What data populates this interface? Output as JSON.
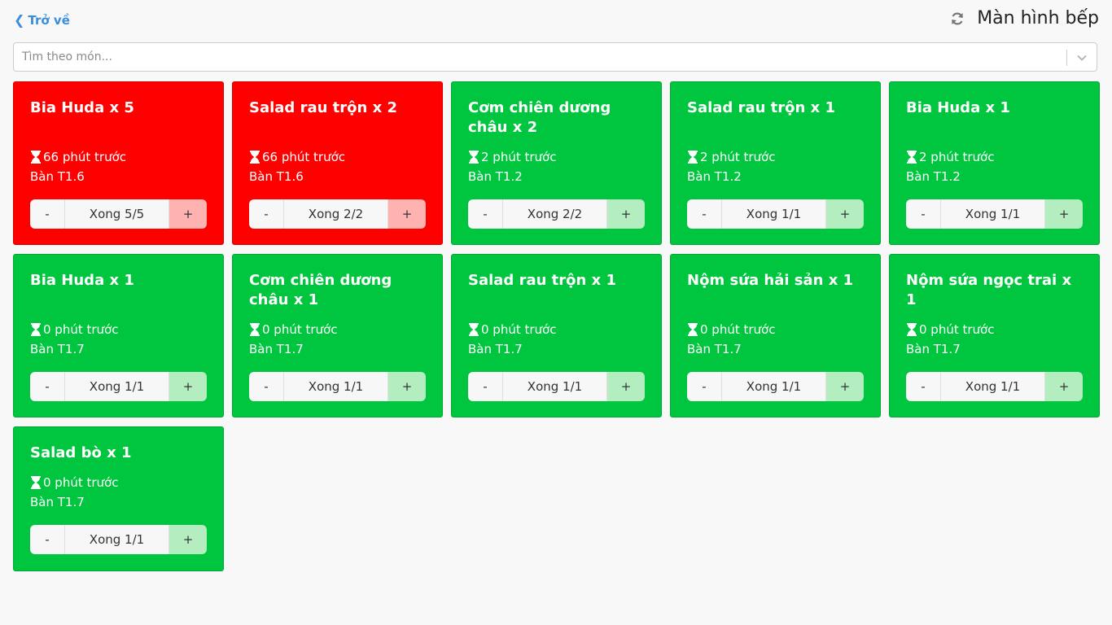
{
  "header": {
    "back_label": "Trở về",
    "title": "Màn hình bếp"
  },
  "search": {
    "placeholder": "Tìm theo món..."
  },
  "cards": [
    {
      "name": "Bia Huda x 5",
      "time": "66 phút trước",
      "table": "Bàn T1.6",
      "status": "Xong 5/5",
      "minus": "-",
      "plus": "+",
      "color": "#ff0000"
    },
    {
      "name": "Salad rau trộn x 2",
      "time": "66 phút trước",
      "table": "Bàn T1.6",
      "status": "Xong 2/2",
      "minus": "-",
      "plus": "+",
      "color": "#ff0000"
    },
    {
      "name": "Cơm chiên dương châu x 2",
      "time": "2 phút trước",
      "table": "Bàn T1.2",
      "status": "Xong 2/2",
      "minus": "-",
      "plus": "+",
      "color": "#00c63f"
    },
    {
      "name": "Salad rau trộn x 1",
      "time": "2 phút trước",
      "table": "Bàn T1.2",
      "status": "Xong 1/1",
      "minus": "-",
      "plus": "+",
      "color": "#00c63f"
    },
    {
      "name": "Bia Huda x 1",
      "time": "2 phút trước",
      "table": "Bàn T1.2",
      "status": "Xong 1/1",
      "minus": "-",
      "plus": "+",
      "color": "#00c63f"
    },
    {
      "name": "Bia Huda x 1",
      "time": "0 phút trước",
      "table": "Bàn T1.7",
      "status": "Xong 1/1",
      "minus": "-",
      "plus": "+",
      "color": "#00c63f"
    },
    {
      "name": "Cơm chiên dương châu x 1",
      "time": "0 phút trước",
      "table": "Bàn T1.7",
      "status": "Xong 1/1",
      "minus": "-",
      "plus": "+",
      "color": "#00c63f"
    },
    {
      "name": "Salad rau trộn x 1",
      "time": "0 phút trước",
      "table": "Bàn T1.7",
      "status": "Xong 1/1",
      "minus": "-",
      "plus": "+",
      "color": "#00c63f"
    },
    {
      "name": "Nộm sứa hải sản x 1",
      "time": "0 phút trước",
      "table": "Bàn T1.7",
      "status": "Xong 1/1",
      "minus": "-",
      "plus": "+",
      "color": "#00c63f"
    },
    {
      "name": "Nộm sứa ngọc trai x 1",
      "time": "0 phút trước",
      "table": "Bàn T1.7",
      "status": "Xong 1/1",
      "minus": "-",
      "plus": "+",
      "color": "#00c63f"
    },
    {
      "name": "Salad bò x 1",
      "time": "0 phút trước",
      "table": "Bàn T1.7",
      "status": "Xong 1/1",
      "minus": "-",
      "plus": "+",
      "color": "#00c63f"
    }
  ]
}
